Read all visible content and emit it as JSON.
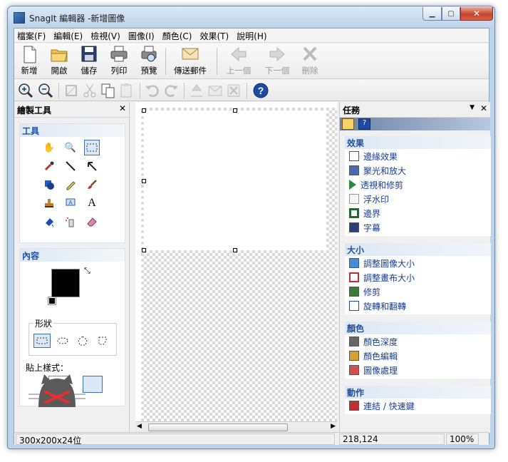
{
  "window": {
    "title": "SnagIt 編輯器 -新增圖像"
  },
  "menu": [
    "檔案(F)",
    "編輯(E)",
    "檢視(V)",
    "圖像(I)",
    "顏色(C)",
    "效果(T)",
    "說明(H)"
  ],
  "toolbar": {
    "new": "新增",
    "open": "開啟",
    "save": "儲存",
    "print": "列印",
    "preview": "預覽",
    "send_mail": "傳送郵件",
    "prev": "上一個",
    "next": "下一個",
    "delete": "刪除"
  },
  "left_panel": {
    "title": "繪製工具",
    "tools_header": "工具",
    "content_header": "內容",
    "shape_label": "形狀",
    "paste_label": "貼上樣式："
  },
  "right_panel": {
    "title": "任務",
    "sections": [
      {
        "header": "效果",
        "items": [
          "邊緣效果",
          "聚光和放大",
          "透視和修剪",
          "浮水印",
          "邊界",
          "字幕"
        ]
      },
      {
        "header": "大小",
        "items": [
          "調整圖像大小",
          "調整畫布大小",
          "修剪",
          "旋轉和翻轉"
        ]
      },
      {
        "header": "顏色",
        "items": [
          "顏色深度",
          "顏色編輯",
          "圖像處理"
        ]
      },
      {
        "header": "動作",
        "items": [
          "連結 / 快速鍵"
        ]
      }
    ]
  },
  "status": {
    "size": "300x200x24位",
    "coords": "218,124",
    "zoom": "100%"
  },
  "colors": {
    "fill": "#000000",
    "accent": "#1f4fa0",
    "close_button": "#c5452b"
  }
}
